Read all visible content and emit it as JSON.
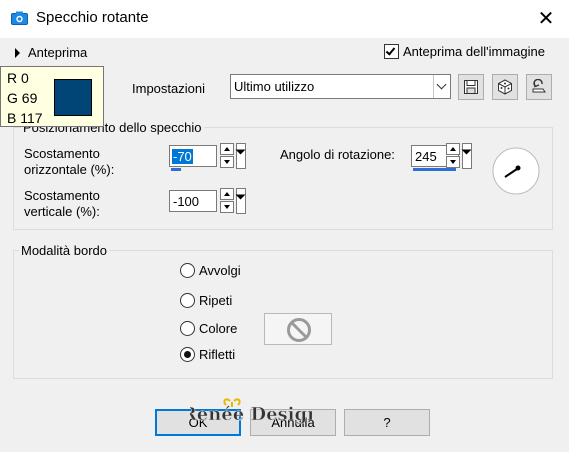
{
  "window": {
    "title": "Specchio rotante"
  },
  "preview": {
    "toggle_label": "Anteprima",
    "image_preview_label": "Anteprima dell'immagine",
    "image_preview_checked": true
  },
  "color_tooltip": {
    "r": "R 0",
    "g": "G 69",
    "b": "B 117",
    "swatch_color": "#004575"
  },
  "settings": {
    "label": "Impostazioni",
    "preset_value": "Ultimo utilizzo"
  },
  "mirror": {
    "title": "Posizionamento dello specchio",
    "h_offset_label_1": "Scostamento",
    "h_offset_label_2": "orizzontale (%):",
    "h_offset_value": "-70",
    "v_offset_label_1": "Scostamento",
    "v_offset_label_2": "verticale (%):",
    "v_offset_value": "-100",
    "rotation_label": "Angolo di rotazione:",
    "rotation_value": "245"
  },
  "border": {
    "title": "Modalità bordo",
    "options": [
      "Avvolgi",
      "Ripeti",
      "Colore",
      "Rifletti"
    ],
    "selected": "Rifletti"
  },
  "buttons": {
    "ok": "OK",
    "cancel": "Annulla",
    "help": "?"
  },
  "watermark": {
    "text": "Renée Design"
  },
  "colors": {
    "accent": "#0078d7",
    "selection": "#2e6fd4"
  }
}
